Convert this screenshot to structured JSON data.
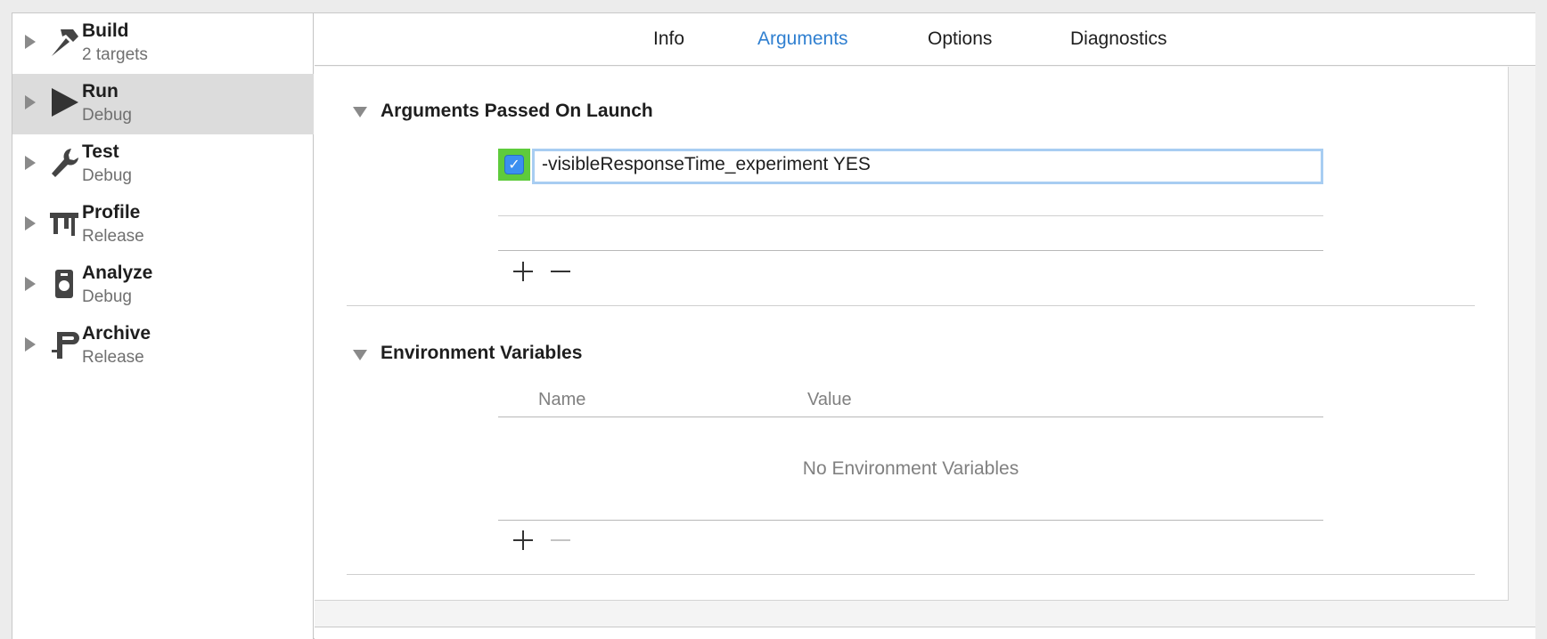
{
  "sidebar": {
    "items": [
      {
        "title": "Build",
        "subtitle": "2 targets",
        "icon": "hammer-icon"
      },
      {
        "title": "Run",
        "subtitle": "Debug",
        "icon": "play-icon"
      },
      {
        "title": "Test",
        "subtitle": "Debug",
        "icon": "wrench-icon"
      },
      {
        "title": "Profile",
        "subtitle": "Release",
        "icon": "calipers-icon"
      },
      {
        "title": "Analyze",
        "subtitle": "Debug",
        "icon": "analyze-icon"
      },
      {
        "title": "Archive",
        "subtitle": "Release",
        "icon": "archive-clamp-icon"
      }
    ],
    "selected": "Run"
  },
  "tabs": [
    "Info",
    "Arguments",
    "Options",
    "Diagnostics"
  ],
  "active_tab": "Arguments",
  "arguments_section": {
    "title": "Arguments Passed On Launch",
    "arguments": [
      {
        "enabled": true,
        "value": "-visibleResponseTime_experiment YES"
      }
    ]
  },
  "env_section": {
    "title": "Environment Variables",
    "columns": [
      "Name",
      "Value"
    ],
    "empty_text": "No Environment Variables"
  },
  "colors": {
    "accent": "#2f7fd0",
    "selection": "#dcdcdc",
    "checkbox_highlight": "#5ecb3c"
  }
}
